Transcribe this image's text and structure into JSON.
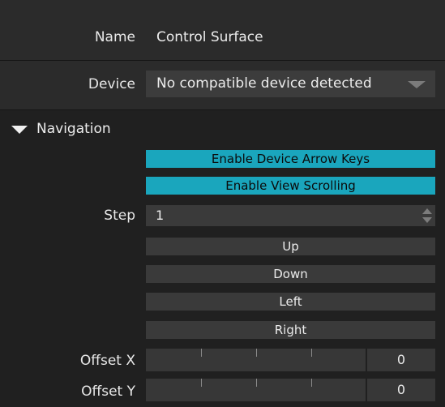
{
  "name_row": {
    "label": "Name",
    "value": "Control Surface"
  },
  "device_row": {
    "label": "Device",
    "selected": "No compatible device detected"
  },
  "navigation": {
    "title": "Navigation",
    "enable_arrow_keys": "Enable Device Arrow Keys",
    "enable_view_scrolling": "Enable View Scrolling",
    "step": {
      "label": "Step",
      "value": "1"
    },
    "buttons": {
      "up": "Up",
      "down": "Down",
      "left": "Left",
      "right": "Right"
    },
    "offset_x": {
      "label": "Offset X",
      "value": "0"
    },
    "offset_y": {
      "label": "Offset Y",
      "value": "0"
    }
  },
  "colors": {
    "accent": "#1aa6bd",
    "panel_bg": "#202020",
    "band_bg": "#2b2b2b",
    "control_bg": "#3a3a3a"
  },
  "icons": {
    "dropdown": "chevron-down-icon",
    "section_toggle": "triangle-down-icon",
    "stepper": "spinner-arrows-icon"
  }
}
